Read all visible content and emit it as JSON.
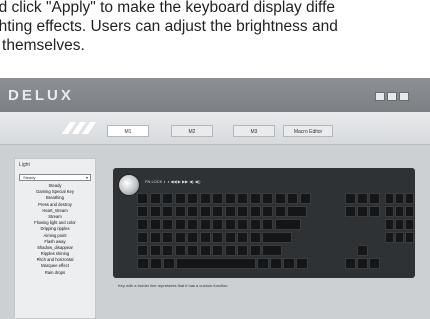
{
  "caption": {
    "line1": "nd click \"Apply\" to make the keyboard display diffe",
    "line2": "ghting effects. Users can adjust the brightness and",
    "line3": "y themselves."
  },
  "app": {
    "logo": "DELUX",
    "tabs": [
      "M1",
      "M2",
      "M3",
      "Macro Editor"
    ],
    "active_tab": "M1"
  },
  "sidebar": {
    "section_label": "Light",
    "dropdown_value": "Steady",
    "effects": [
      "Steady",
      "Gaming Special Key",
      "Breathing",
      "Press and destroy",
      "Heart_stream",
      "Stream",
      "Flowing light and color",
      "Dripping ripples",
      "Aiming point",
      "Flash away",
      "Shadow_disappear",
      "Ripples shining",
      "Pitch and horizontal",
      "Marquee effect",
      "Rain drops"
    ]
  },
  "keyboard": {
    "hint": "Key with a border line represents that it has a custom function.",
    "top_row_text": "FN  LOCK   ◐   ◑   ◀◀  ▶  ▶▶   ◀)  ◀))"
  }
}
